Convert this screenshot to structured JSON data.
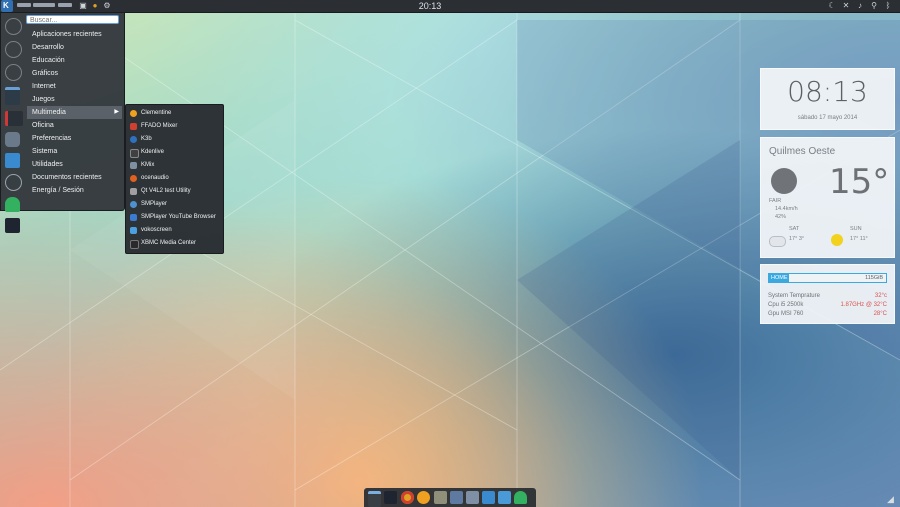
{
  "panel": {
    "clock": "20:13",
    "launcher_letter": "K",
    "tray_icons": [
      "moon-icon",
      "network-off-icon",
      "volume-icon",
      "usb-icon",
      "bluetooth-icon"
    ]
  },
  "menu": {
    "search_placeholder": "Buscar...",
    "items": [
      {
        "label": "Aplicaciones recientes"
      },
      {
        "label": "Desarrollo"
      },
      {
        "label": "Educación"
      },
      {
        "label": "Gráficos"
      },
      {
        "label": "Internet"
      },
      {
        "label": "Juegos"
      },
      {
        "label": "Multimedia"
      },
      {
        "label": "Oficina"
      },
      {
        "label": "Preferencias"
      },
      {
        "label": "Sistema"
      },
      {
        "label": "Utilidades"
      },
      {
        "label": "Documentos recientes"
      },
      {
        "label": "Energía / Sesión"
      }
    ],
    "active_index": 6,
    "favorites": [
      "back-icon",
      "refresh-icon",
      "clock-icon",
      "terminal-icon",
      "bookmarks-icon",
      "search-tool-icon",
      "st-icon",
      "zoom-icon",
      "ghost-icon",
      "dark-st-icon"
    ]
  },
  "submenu": {
    "items": [
      {
        "label": "Clementine",
        "color": "#f0a020"
      },
      {
        "label": "FFADO Mixer",
        "color": "#d04030"
      },
      {
        "label": "K3b",
        "color": "#3070c0"
      },
      {
        "label": "Kdenlive",
        "color": "#404040"
      },
      {
        "label": "KMix",
        "color": "#8090a0"
      },
      {
        "label": "ocenaudio",
        "color": "#e06020"
      },
      {
        "label": "Qt V4L2 test Utility",
        "color": "#a0a0a0"
      },
      {
        "label": "SMPlayer",
        "color": "#5090d0"
      },
      {
        "label": "SMPlayer YouTube Browser",
        "color": "#3a7ad0"
      },
      {
        "label": "vokoscreen",
        "color": "#4aa0e0"
      },
      {
        "label": "XBMC Media Center",
        "color": "#2a2a2a"
      }
    ]
  },
  "clock_widget": {
    "time": "08:13",
    "date": "sábado 17 mayo 2014"
  },
  "weather": {
    "city": "Quilmes Oeste",
    "temp": "15°",
    "condition": "FAIR",
    "wind": "14.4km/h",
    "humidity": "42%",
    "day1": "SAT",
    "day1_temp": "17° 3°",
    "day2": "SUN",
    "day2_temp": "17° 11°"
  },
  "system": {
    "disk_label": "HOME",
    "disk_size": "115GiB",
    "disk_fill": 0.17,
    "rows": [
      {
        "label": "System Temprature",
        "value": "32°c"
      },
      {
        "label": "Cpu i5 2500k",
        "value": "1.87GHz @ 32°C"
      },
      {
        "label": "Gpu MSI 760",
        "value": "28°C"
      }
    ]
  },
  "dock": {
    "items": [
      {
        "name": "terminal-icon",
        "color": "#3a3f45"
      },
      {
        "name": "st-dark-icon",
        "color": "#1e2530"
      },
      {
        "name": "chrome-icon",
        "color": "#e0a020"
      },
      {
        "name": "clementine-icon",
        "color": "#f0a020"
      },
      {
        "name": "gimp-icon",
        "color": "#8f8f7a"
      },
      {
        "name": "nautilus-icon",
        "color": "#5e7aa0"
      },
      {
        "name": "matlab-icon",
        "color": "#7f8fa5"
      },
      {
        "name": "download-icon",
        "color": "#3a8ad0"
      },
      {
        "name": "monitor-icon",
        "color": "#4a9ad8"
      },
      {
        "name": "pacman-ghost-icon",
        "color": "#33b060"
      },
      {
        "name": "sleep-icon",
        "color": "#555b62"
      }
    ]
  }
}
